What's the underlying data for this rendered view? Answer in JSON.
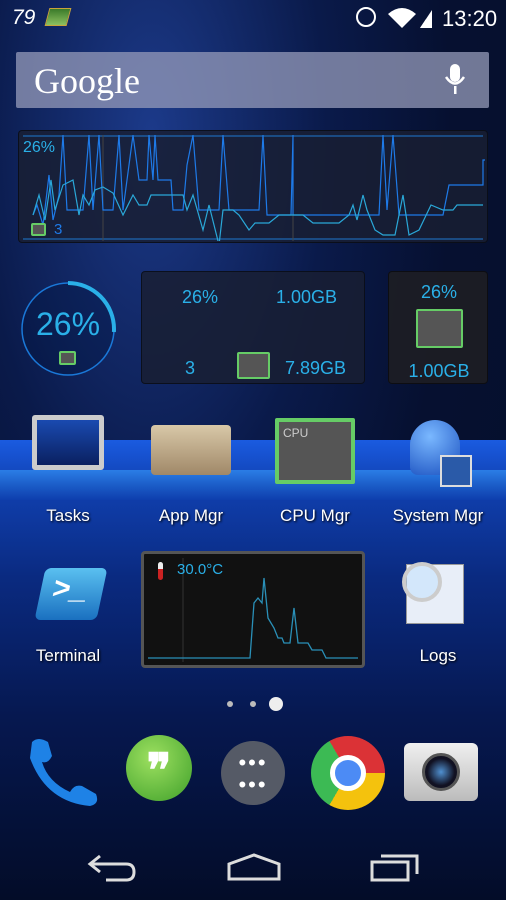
{
  "status_bar": {
    "notification_count": "79",
    "time": "13:20",
    "icons": [
      "ram-icon",
      "alarm-icon",
      "wifi-icon",
      "signal-icon"
    ]
  },
  "search": {
    "label": "Google",
    "mic": "mic-icon"
  },
  "cpu_graph_widget": {
    "percent": "26%",
    "cores": "3"
  },
  "gauge_widget": {
    "percent": "26%",
    "value": 0.26
  },
  "info_widget": {
    "cpu_percent": "26%",
    "ram_free": "1.00GB",
    "cores": "3",
    "ram_total": "7.89GB"
  },
  "small_widget": {
    "cpu_percent": "26%",
    "ram_free": "1.00GB"
  },
  "apps": [
    {
      "label": "Tasks"
    },
    {
      "label": "App Mgr"
    },
    {
      "label": "CPU Mgr"
    },
    {
      "label": "System Mgr"
    },
    {
      "label": "Terminal"
    },
    {
      "label": "Logs"
    }
  ],
  "temp_widget": {
    "temperature": "30.0°C"
  },
  "page_indicator": {
    "pages": 3,
    "current": 3
  },
  "dock": [
    "phone-icon",
    "hangouts-icon",
    "app-drawer-icon",
    "chrome-icon",
    "camera-icon"
  ],
  "nav": [
    "back-icon",
    "home-icon",
    "recents-icon"
  ],
  "colors": {
    "accent": "#2ab0e8",
    "chip_green": "#66cc66"
  }
}
